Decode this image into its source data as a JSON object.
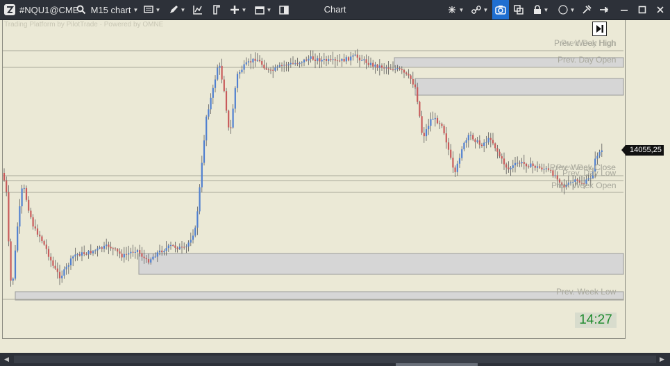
{
  "toolbar": {
    "symbol": "#NQU1@CME",
    "timeframe": "M15 chart",
    "window_title": "Chart",
    "icons": [
      "app-logo-icon",
      "search-icon",
      "template-icon",
      "pencil-icon",
      "indicators-icon",
      "drawings-icon",
      "crosshair-icon",
      "window-icon",
      "columns-icon",
      "pan-icon",
      "link-icon",
      "camera-icon",
      "copy-window-icon",
      "lock-icon",
      "color-circle-icon",
      "tools-icon",
      "pin-icon",
      "minimize-icon",
      "maximize-icon",
      "close-icon"
    ]
  },
  "chart": {
    "watermark": "Trading Platform by PilotTrade · Powered by OMNE",
    "current_price": "14055,25",
    "clock": "14:27",
    "colors": {
      "background": "#ebe9d6",
      "up": "#4f7fd0",
      "down": "#c85a5a",
      "level_line": "#a9a99b",
      "zone": "#d6d6d6"
    },
    "levels": [
      {
        "label": "Prev. Week High",
        "price": 14128.5
      },
      {
        "label": "Prev. Day High",
        "price": 14127.0
      },
      {
        "label": "Prev. Day Open",
        "price": 14120.0
      },
      {
        "label": "Prev. Week Close",
        "price": 14047.5
      },
      {
        "label": "Prev. Day Low",
        "price": 14045.0
      },
      {
        "label": "Prev. Day Close",
        "price": 14043.5
      },
      {
        "label": "Prev. Week Open",
        "price": 14039.0
      },
      {
        "label": "Prev. Week Low",
        "price": 13980.0
      }
    ]
  }
}
